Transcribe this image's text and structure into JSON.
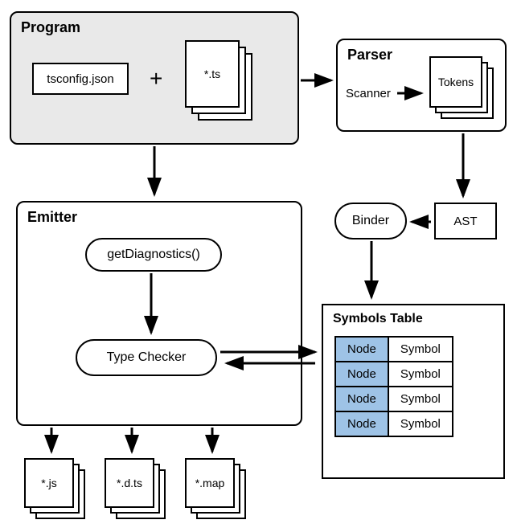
{
  "program": {
    "title": "Program",
    "config_label": "tsconfig.json",
    "plus": "+",
    "ts_files_label": "*.ts"
  },
  "parser": {
    "title": "Parser",
    "scanner_label": "Scanner",
    "tokens_label": "Tokens"
  },
  "binder": {
    "label": "Binder"
  },
  "ast": {
    "label": "AST"
  },
  "emitter": {
    "title": "Emitter",
    "diagnostics_label": "getDiagnostics()",
    "typechecker_label": "Type Checker"
  },
  "symbols": {
    "title": "Symbols Table",
    "rows": [
      {
        "node": "Node",
        "symbol": "Symbol"
      },
      {
        "node": "Node",
        "symbol": "Symbol"
      },
      {
        "node": "Node",
        "symbol": "Symbol"
      },
      {
        "node": "Node",
        "symbol": "Symbol"
      }
    ]
  },
  "outputs": {
    "js_label": "*.js",
    "dts_label": "*.d.ts",
    "map_label": "*.map"
  }
}
